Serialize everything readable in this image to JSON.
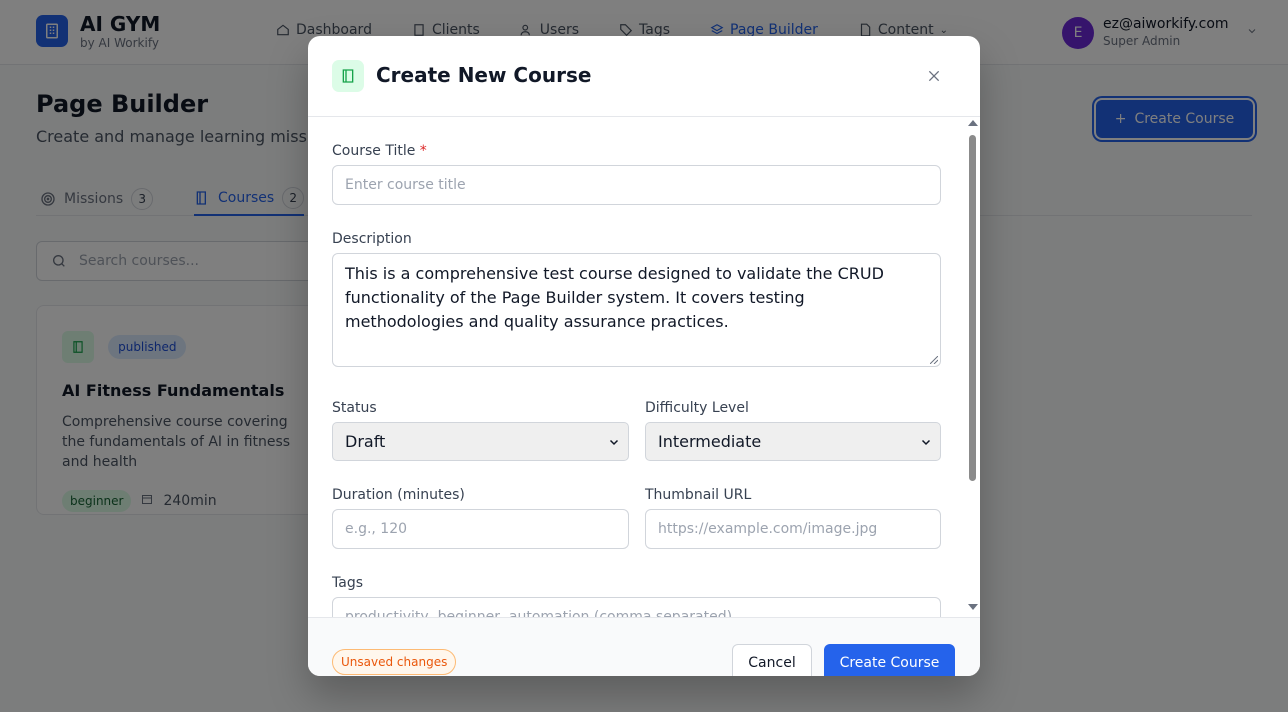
{
  "app": {
    "title": "AI GYM",
    "subtitle": "by AI Workify"
  },
  "nav": {
    "items": [
      {
        "label": "Dashboard",
        "icon": "home-icon"
      },
      {
        "label": "Clients",
        "icon": "building-icon"
      },
      {
        "label": "Users",
        "icon": "users-icon"
      },
      {
        "label": "Tags",
        "icon": "tag-icon"
      },
      {
        "label": "Page Builder",
        "icon": "layers-icon",
        "active": true
      },
      {
        "label": "Content",
        "icon": "document-icon"
      }
    ]
  },
  "user": {
    "avatar_letter": "E",
    "email": "ez@aiworkify.com",
    "role": "Super Admin"
  },
  "page": {
    "title": "Page Builder",
    "subtitle": "Create and manage learning missions and courses",
    "create_button": "Create Course"
  },
  "tabs": [
    {
      "label": "Missions",
      "count": "3"
    },
    {
      "label": "Courses",
      "count": "2",
      "active": true
    }
  ],
  "search": {
    "placeholder": "Search courses..."
  },
  "course_card": {
    "status": "published",
    "title": "AI Fitness Fundamentals",
    "description": "Comprehensive course covering the fundamentals of AI in fitness and health",
    "level": "beginner",
    "duration": "240min"
  },
  "modal": {
    "title": "Create New Course",
    "fields": {
      "course_title": {
        "label": "Course Title",
        "required_mark": "*",
        "placeholder": "Enter course title"
      },
      "description": {
        "label": "Description",
        "value": "This is a comprehensive test course designed to validate the CRUD functionality of the Page Builder system. It covers testing methodologies and quality assurance practices."
      },
      "status": {
        "label": "Status",
        "value": "Draft"
      },
      "difficulty": {
        "label": "Difficulty Level",
        "value": "Intermediate"
      },
      "duration": {
        "label": "Duration (minutes)",
        "placeholder": "e.g., 120"
      },
      "thumbnail": {
        "label": "Thumbnail URL",
        "placeholder": "https://example.com/image.jpg"
      },
      "tags": {
        "label": "Tags",
        "placeholder": "productivity, beginner, automation (comma separated)"
      }
    },
    "footer": {
      "unsaved": "Unsaved changes",
      "cancel": "Cancel",
      "create": "Create Course"
    }
  },
  "colors": {
    "primary": "#2563eb",
    "overlay": "rgba(0,0,0,0.5)",
    "success_bg": "#dcfce7",
    "warning": "#ea580c"
  }
}
